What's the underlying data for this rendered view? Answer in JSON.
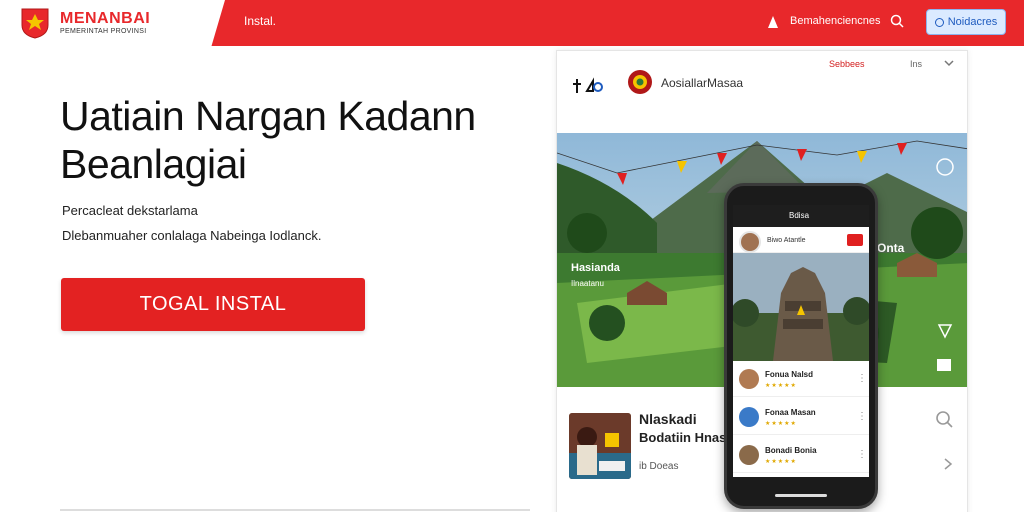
{
  "header": {
    "brand_name": "MENANBAI",
    "brand_tagline": "PEMERINTAH PROVINSI",
    "nav_install": "Instal.",
    "profile_link": "Bemahenciencnes",
    "button_label": "Noidacres",
    "colors": {
      "bar": "#e8282b",
      "button_bg": "#dbeaff",
      "button_text": "#1e5bbf"
    }
  },
  "hero": {
    "title_line1": "Uatiain Nargan Kadann",
    "title_line2": "Beanlagiai",
    "subtitle_line1": "Percacleat dekstarlama",
    "subtitle_line2": "Dlebanmuaher conlalaga Nabeinga Iodlanck.",
    "cta_label": "TOGAL INSTAL",
    "cta_color": "#e32222"
  },
  "card": {
    "account_name": "AosiallarMasaa",
    "red_link": "Sebbees",
    "gray_label": "Ins",
    "scene_caption": "Hasianda",
    "scene_caption2": "Ilnaatanu",
    "scene_label_right": "Onta",
    "video_title": "Nlaskadi",
    "video_subtitle": "Bodatiin Hnasa",
    "video_meta": "ib Doeas",
    "icons": [
      "tiktok-icon",
      "emblem-icon",
      "chevron-down-icon",
      "search-icon",
      "chevron-right-icon"
    ]
  },
  "phone": {
    "top_title": "Bdisa",
    "user_name": "Biwo Atantle",
    "rows": [
      {
        "name": "Fonua Nalsd",
        "rating": "★★★★★"
      },
      {
        "name": "Fonaa Masan",
        "rating": "★★★★★"
      },
      {
        "name": "Bonadi Bonia",
        "rating": "★★★★★"
      }
    ]
  }
}
